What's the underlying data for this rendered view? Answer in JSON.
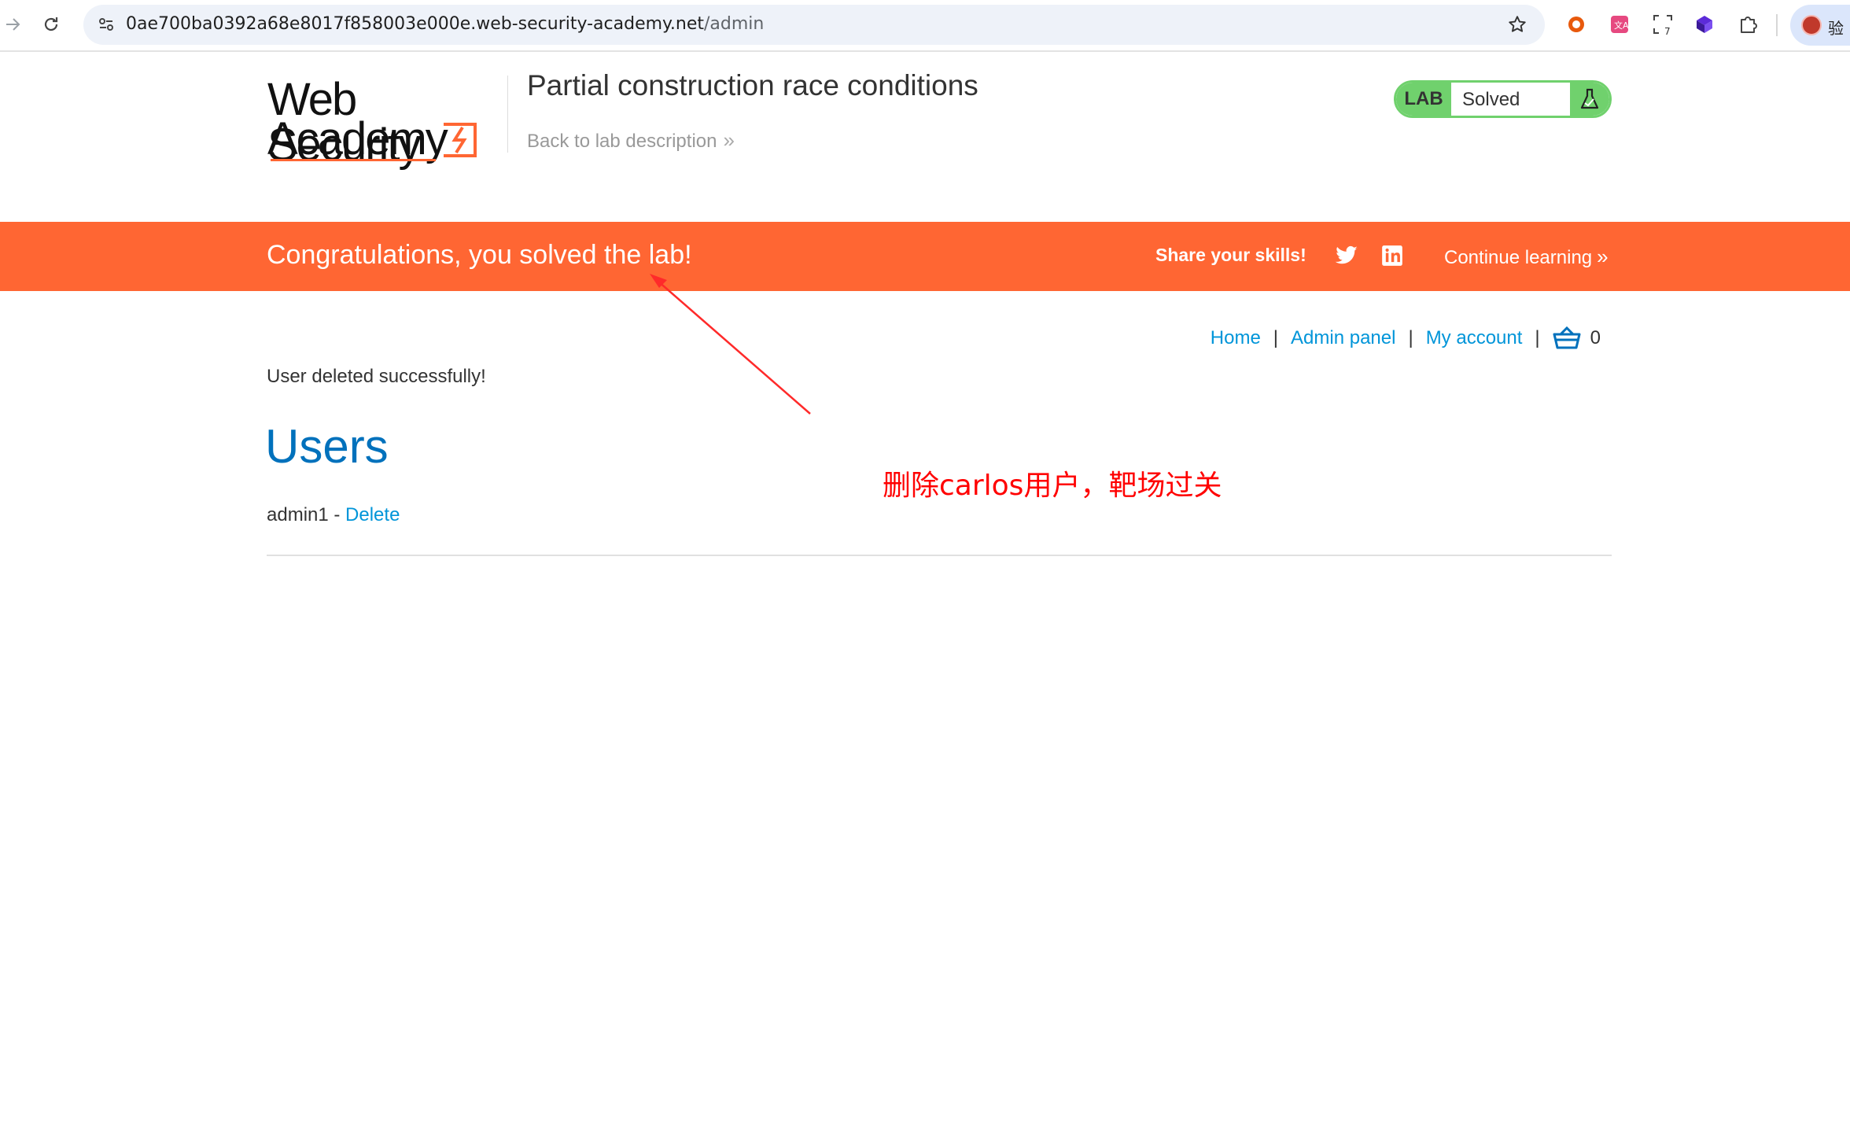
{
  "browser": {
    "url_host": "0ae700ba0392a68e8017f858003e000e.web-security-academy.net",
    "url_path": "/admin",
    "forward_icon": "arrow-right-icon",
    "reload_icon": "reload-icon",
    "bookmark_icon": "star-icon",
    "extensions": [
      "record-extension-icon",
      "translate-extension-icon",
      "screenshot-extension-icon",
      "cube-extension-icon",
      "puzzle-extensions-icon"
    ],
    "extension_badge": "7",
    "profile_label": "验"
  },
  "logo": {
    "line1": "Web Security",
    "line2": "Academy",
    "accent_color": "#ff6633"
  },
  "lab": {
    "title": "Partial construction race conditions",
    "back_link": "Back to lab description",
    "status_tag": "LAB",
    "status_text": "Solved",
    "status_color": "#70d16d",
    "flask_icon": "flask-icon"
  },
  "banner": {
    "message": "Congratulations, you solved the lab!",
    "share_label": "Share your skills!",
    "twitter_icon": "twitter-icon",
    "linkedin_icon": "linkedin-icon",
    "continue_label": "Continue learning",
    "background_color": "#ff6633"
  },
  "nav": {
    "home": "Home",
    "admin_panel": "Admin panel",
    "my_account": "My account",
    "separator": "|",
    "cart_icon": "cart-icon",
    "cart_count": "0"
  },
  "content": {
    "message": "User deleted successfully!",
    "heading": "Users",
    "users": [
      {
        "name": "admin1",
        "separator": " - ",
        "action": "Delete"
      }
    ]
  },
  "annotation": {
    "text": "删除carlos用户，靶场过关",
    "color": "#ff0000"
  }
}
